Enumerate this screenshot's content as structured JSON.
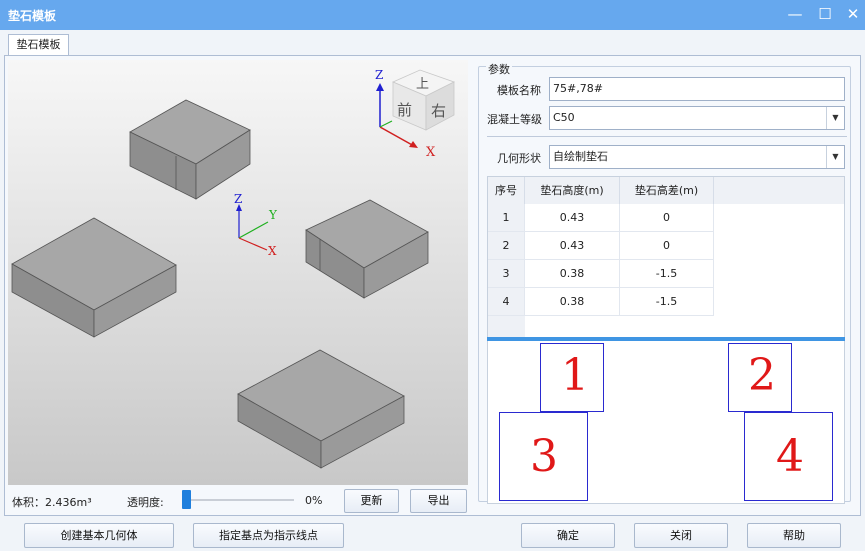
{
  "window": {
    "title": "垫石模板",
    "min_icon": "minimize-icon",
    "max_icon": "maximize-icon",
    "close_icon": "close-icon"
  },
  "tab": {
    "label": "垫石模板"
  },
  "viewport": {
    "axis_large": {
      "z": "Z",
      "x": "X"
    },
    "axis_small": {
      "z": "Z",
      "y": "Y",
      "x": "X"
    },
    "view_cube": {
      "top": "上",
      "front": "前",
      "right": "右"
    }
  },
  "params": {
    "group_title": "参数",
    "template_name_label": "模板名称",
    "template_name_value": "75#,78#",
    "concrete_label": "混凝土等级",
    "concrete_value": "C50",
    "shape_label": "几何形状",
    "shape_value": "自绘制垫石"
  },
  "table": {
    "headers": [
      "序号",
      "垫石高度(m)",
      "垫石高差(m)"
    ],
    "rows": [
      [
        "1",
        "0.43",
        "0"
      ],
      [
        "2",
        "0.43",
        "0"
      ],
      [
        "3",
        "0.38",
        "-1.5"
      ],
      [
        "4",
        "0.38",
        "-1.5"
      ]
    ]
  },
  "preview_labels": [
    "1",
    "2",
    "3",
    "4"
  ],
  "status": {
    "volume": "体积：2.436m³",
    "opacity_label": "透明度:",
    "opacity_value": "0%",
    "opacity_fraction": 0
  },
  "buttons": {
    "update": "更新",
    "export": "导出",
    "create_basic": "创建基本几何体",
    "set_base_point": "指定基点为指示线点",
    "ok": "确定",
    "close": "关闭",
    "help": "帮助"
  },
  "colors": {
    "titlebar": "#66a8ee",
    "pad_outline": "#2a2ad0",
    "pad_number": "#e01818",
    "accent": "#1f7fdd"
  }
}
